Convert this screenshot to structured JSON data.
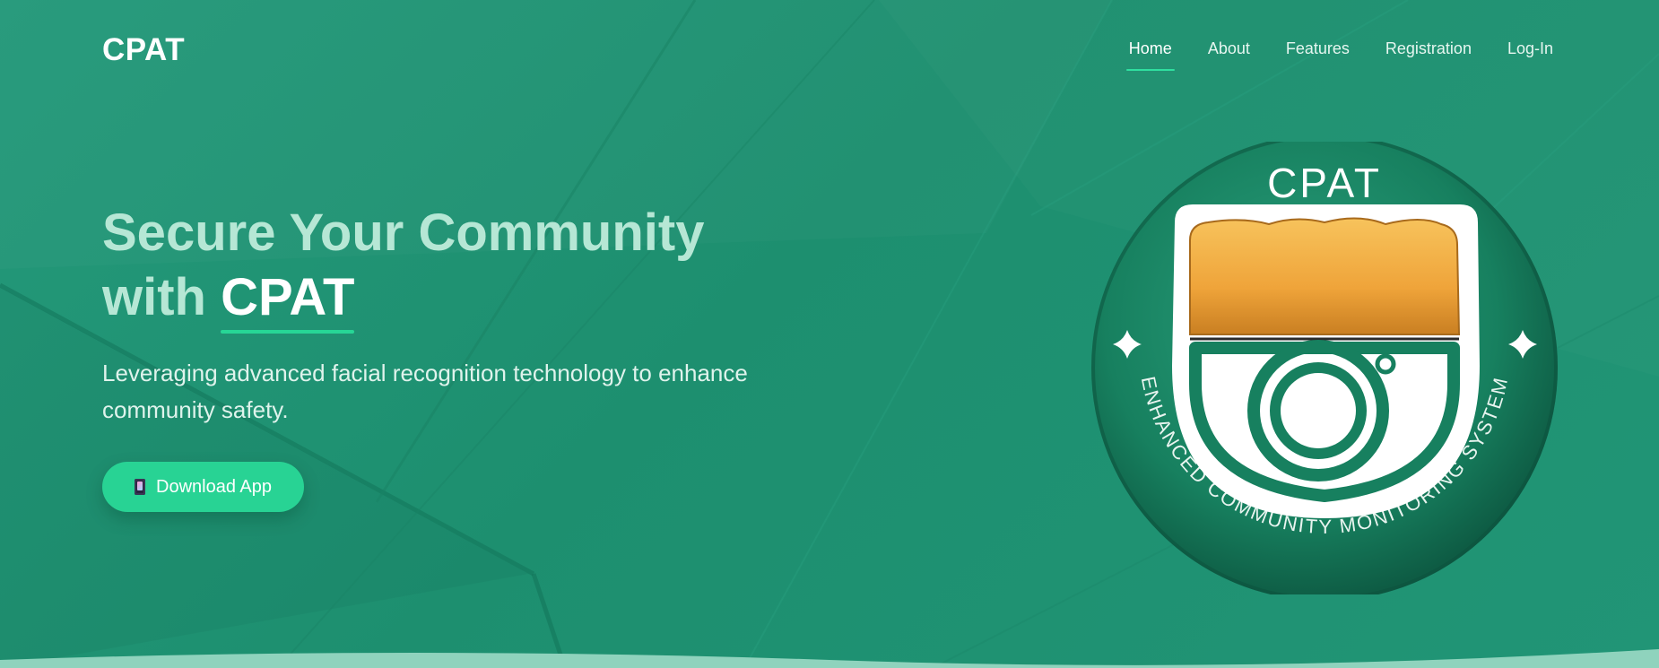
{
  "brand": "CPAT",
  "nav": {
    "items": [
      {
        "label": "Home",
        "active": true
      },
      {
        "label": "About",
        "active": false
      },
      {
        "label": "Features",
        "active": false
      },
      {
        "label": "Registration",
        "active": false
      },
      {
        "label": "Log-In",
        "active": false
      }
    ]
  },
  "hero": {
    "title_line1": "Secure Your Community",
    "title_with": "with",
    "title_accent": "CPAT",
    "subtitle": "Leveraging advanced facial recognition technology to enhance community safety.",
    "download_button": "Download App",
    "download_icon": "phone-icon"
  },
  "emblem": {
    "title": "CPAT",
    "ring_text": "ENHANCED COMMUNITY MONITORING SYSTEM"
  },
  "colors": {
    "background": "#1f9473",
    "accent": "#28d394",
    "headline": "#b6e7d5",
    "emblem_gold": "#f2a93c",
    "emblem_green": "#17805f"
  }
}
